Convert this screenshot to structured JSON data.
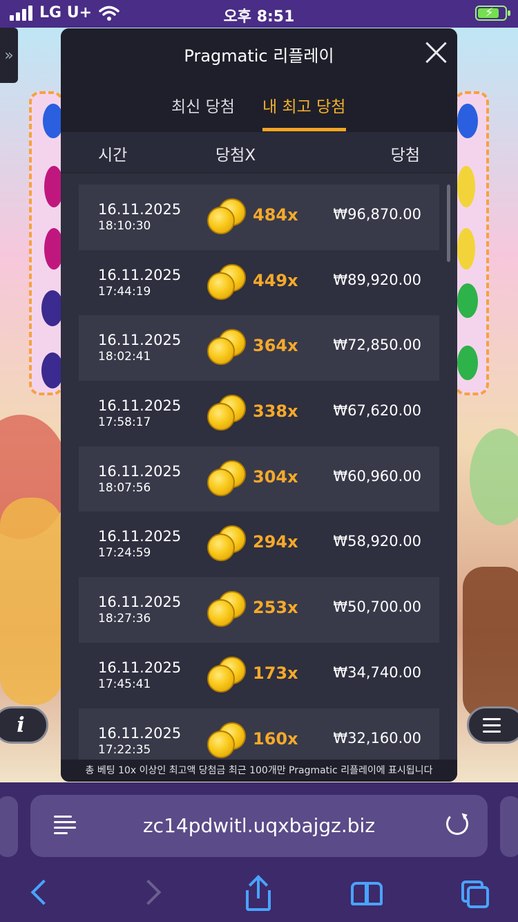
{
  "status_bar": {
    "carrier": "LG U+",
    "time": "오후 8:51"
  },
  "modal": {
    "title": "Pragmatic 리플레이",
    "tabs": [
      {
        "label": "최신 당첨",
        "active": false
      },
      {
        "label": "내 최고 당첨",
        "active": true
      }
    ],
    "columns": {
      "time": "시간",
      "multiplier": "당첨X",
      "win": "당첨"
    },
    "rows": [
      {
        "date": "16.11.2025",
        "time": "18:10:30",
        "multiplier": "484x",
        "win": "₩96,870.00"
      },
      {
        "date": "16.11.2025",
        "time": "17:44:19",
        "multiplier": "449x",
        "win": "₩89,920.00"
      },
      {
        "date": "16.11.2025",
        "time": "18:02:41",
        "multiplier": "364x",
        "win": "₩72,850.00"
      },
      {
        "date": "16.11.2025",
        "time": "17:58:17",
        "multiplier": "338x",
        "win": "₩67,620.00"
      },
      {
        "date": "16.11.2025",
        "time": "18:07:56",
        "multiplier": "304x",
        "win": "₩60,960.00"
      },
      {
        "date": "16.11.2025",
        "time": "17:24:59",
        "multiplier": "294x",
        "win": "₩58,920.00"
      },
      {
        "date": "16.11.2025",
        "time": "18:27:36",
        "multiplier": "253x",
        "win": "₩50,700.00"
      },
      {
        "date": "16.11.2025",
        "time": "17:45:41",
        "multiplier": "173x",
        "win": "₩34,740.00"
      },
      {
        "date": "16.11.2025",
        "time": "17:22:35",
        "multiplier": "160x",
        "win": "₩32,160.00"
      }
    ],
    "footer_note": "총 베팅 10x 이상인 최고액 당첨금 최근 100개만 Pragmatic 리플레이에 표시됩니다"
  },
  "game": {
    "info_label": "i",
    "expand_label": "»"
  },
  "browser": {
    "url": "zc14pdwitl.uqxbajgz.biz"
  },
  "colors": {
    "accent_orange": "#f5a623",
    "modal_bg": "#2e2f3f",
    "browser_bg": "#3c2a6a",
    "ios_blue": "#4aa3ff"
  },
  "icons": [
    "signal-icon",
    "wifi-icon",
    "battery-charging-icon",
    "close-icon",
    "coin-stack-icon",
    "info-icon",
    "menu-icon",
    "reader-icon",
    "reload-icon",
    "back-icon",
    "forward-icon",
    "share-icon",
    "bookmarks-icon",
    "tabs-icon"
  ]
}
